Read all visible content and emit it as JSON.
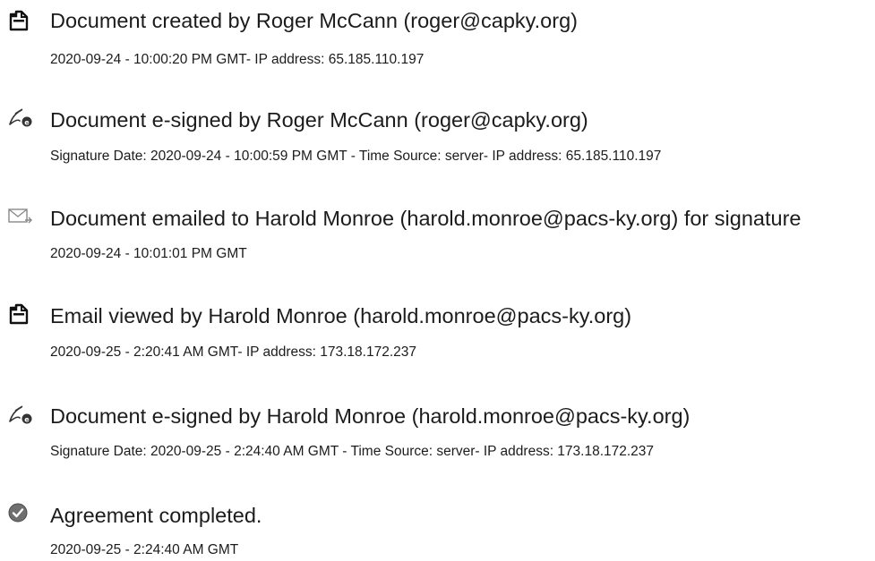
{
  "audit_events": [
    {
      "icon": "document-created-icon",
      "headline": "Document created by Roger McCann (roger@capky.org)",
      "detail": "2020-09-24 - 10:00:20 PM GMT- IP address: 65.185.110.197"
    },
    {
      "icon": "signature-pen-icon",
      "headline": "Document e-signed by Roger McCann (roger@capky.org)",
      "detail": "Signature Date: 2020-09-24 - 10:00:59 PM GMT - Time Source: server- IP address: 65.185.110.197"
    },
    {
      "icon": "email-sent-icon",
      "headline": "Document emailed to Harold Monroe (harold.monroe@pacs-ky.org) for signature",
      "detail": "2020-09-24 - 10:01:01 PM GMT"
    },
    {
      "icon": "document-viewed-icon",
      "headline": "Email viewed by Harold Monroe (harold.monroe@pacs-ky.org)",
      "detail": "2020-09-25 - 2:20:41 AM GMT- IP address: 173.18.172.237"
    },
    {
      "icon": "signature-pen-icon",
      "headline": "Document e-signed by Harold Monroe (harold.monroe@pacs-ky.org)",
      "detail": "Signature Date: 2020-09-25 - 2:24:40 AM GMT - Time Source: server- IP address: 173.18.172.237"
    },
    {
      "icon": "checkmark-circle-icon",
      "headline": "Agreement completed.",
      "detail": "2020-09-25 - 2:24:40 AM GMT"
    }
  ]
}
